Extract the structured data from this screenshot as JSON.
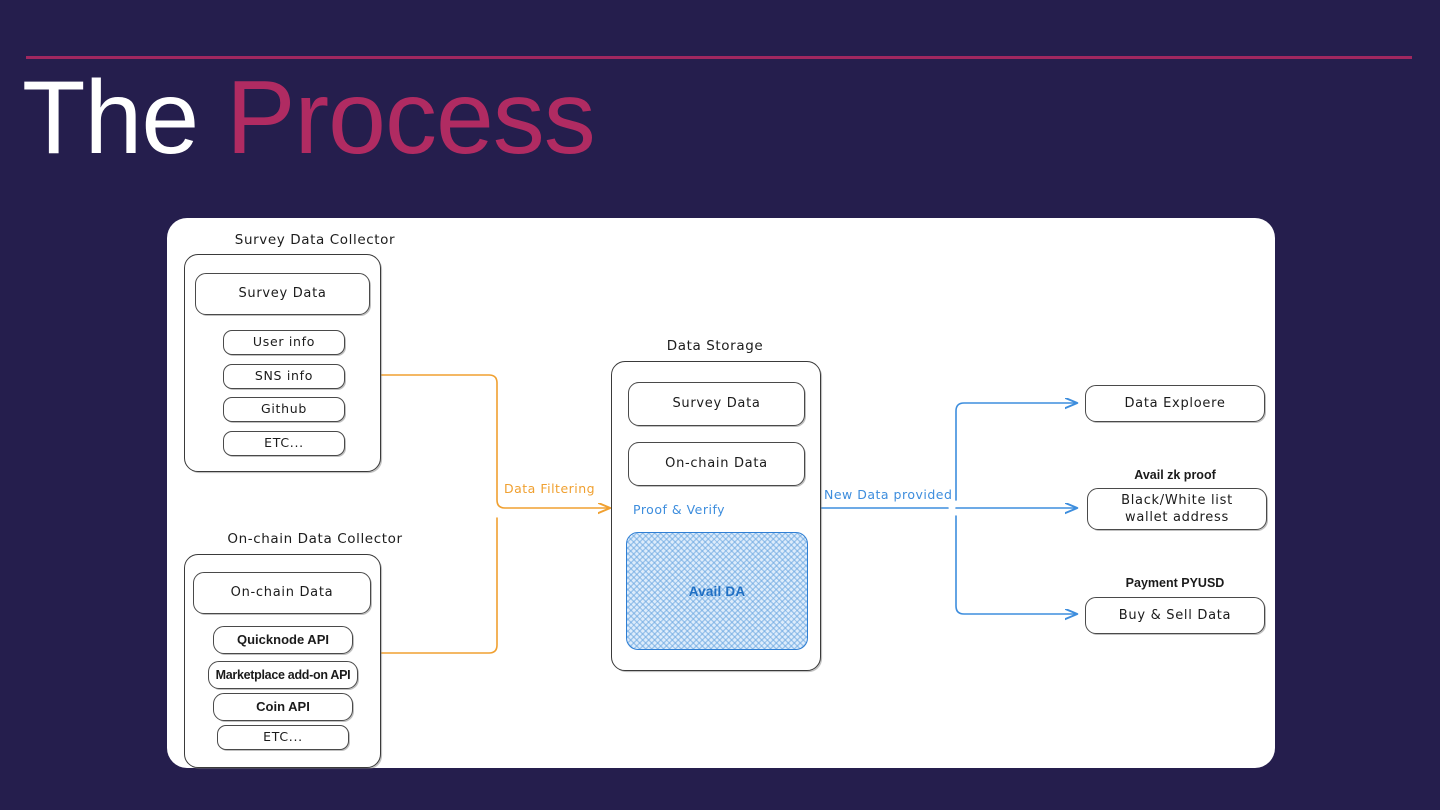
{
  "header": {
    "title_part1": "The",
    "title_part2": "Process"
  },
  "colors": {
    "background": "#251e4d",
    "rule": "#a1275f",
    "title_white": "#ffffff",
    "title_accent": "#b02b62",
    "panel": "#ffffff",
    "wire_orange": "#f0a030",
    "wire_blue": "#3d8ddd",
    "avail_border": "#2f7fd4",
    "avail_text": "#1f6fc4"
  },
  "diagram": {
    "survey_collector": {
      "title": "Survey Data Collector",
      "main_node": "Survey Data",
      "items": [
        "User info",
        "SNS info",
        "Github",
        "ETC..."
      ]
    },
    "onchain_collector": {
      "title": "On-chain Data Collector",
      "main_node": "On-chain Data",
      "items": [
        "Quicknode API",
        "Marketplace add-on API",
        "Coin API",
        "ETC..."
      ]
    },
    "data_storage": {
      "title": "Data Storage",
      "nodes": [
        "Survey Data",
        "On-chain Data"
      ],
      "proof_label": "Proof & Verify",
      "avail": "Avail DA"
    },
    "outputs": [
      {
        "caption": "",
        "label": "Data Exploere"
      },
      {
        "caption": "Avail zk proof",
        "label": "Black/White list\nwallet address"
      },
      {
        "caption": "Payment PYUSD",
        "label": "Buy & Sell Data"
      }
    ],
    "edges": {
      "filtering": "Data Filtering",
      "provided": "New Data provided"
    }
  }
}
